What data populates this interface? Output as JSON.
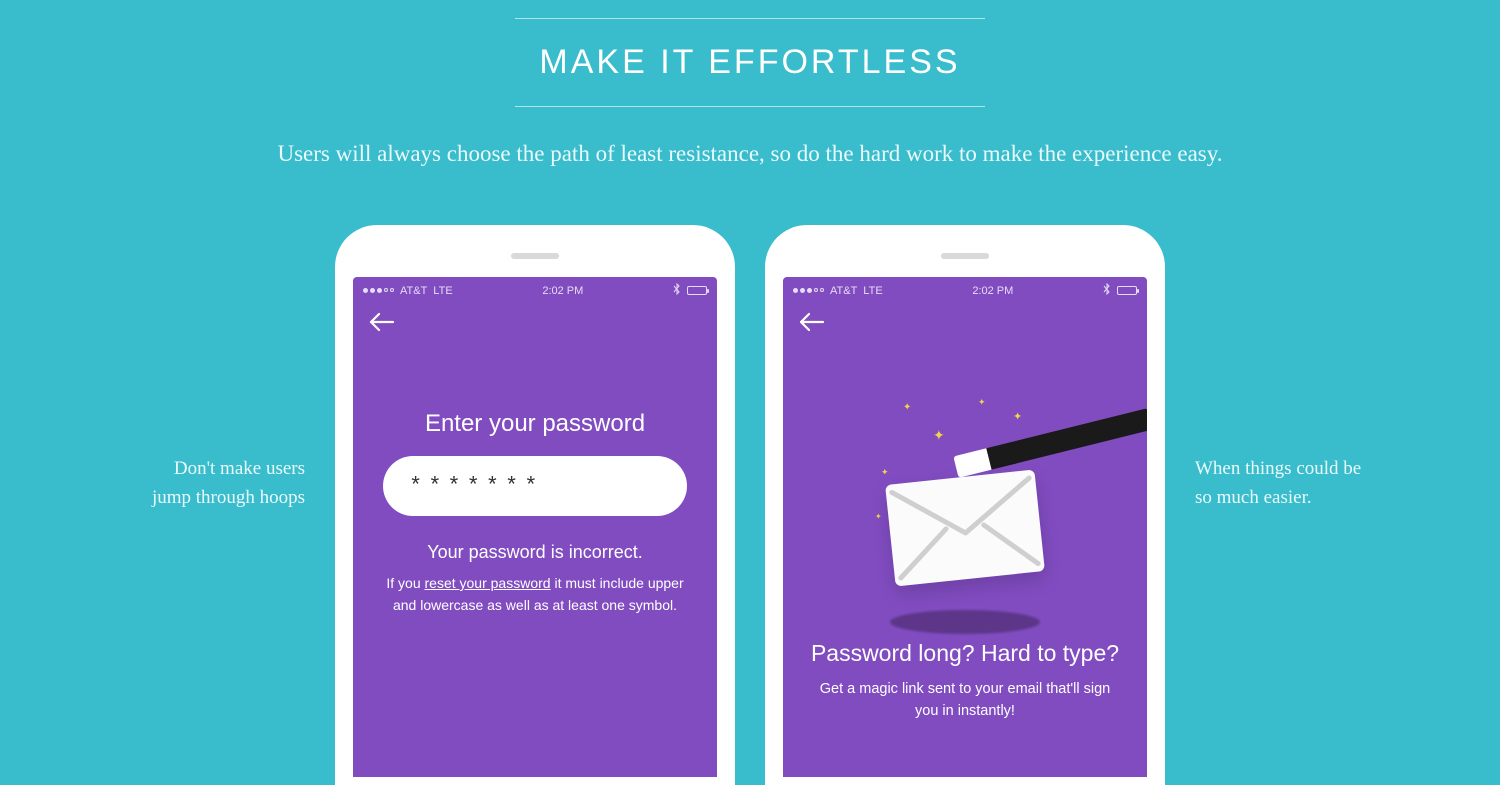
{
  "header": {
    "title": "MAKE IT EFFORTLESS",
    "subtitle": "Users will always choose the path of least resistance, so do the hard work to make the experience easy."
  },
  "captions": {
    "left_line1": "Don't make users",
    "left_line2": "jump through hoops",
    "right_line1": "When things could be",
    "right_line2": "so much easier."
  },
  "statusbar": {
    "carrier": "AT&T",
    "network": "LTE",
    "time": "2:02 PM"
  },
  "screen1": {
    "label": "Enter your password",
    "password_mask": "*******",
    "error": "Your password is incorrect.",
    "hint_prefix": "If you ",
    "hint_link": "reset your password",
    "hint_suffix": " it must include upper and lowercase as well as at least one symbol."
  },
  "screen2": {
    "title": "Password long? Hard to type?",
    "subtitle": "Get a magic link sent to your email that'll sign you in instantly!"
  },
  "colors": {
    "background": "#39bccb",
    "phone_screen": "#814cc0",
    "sparkle": "#f6d24a"
  }
}
